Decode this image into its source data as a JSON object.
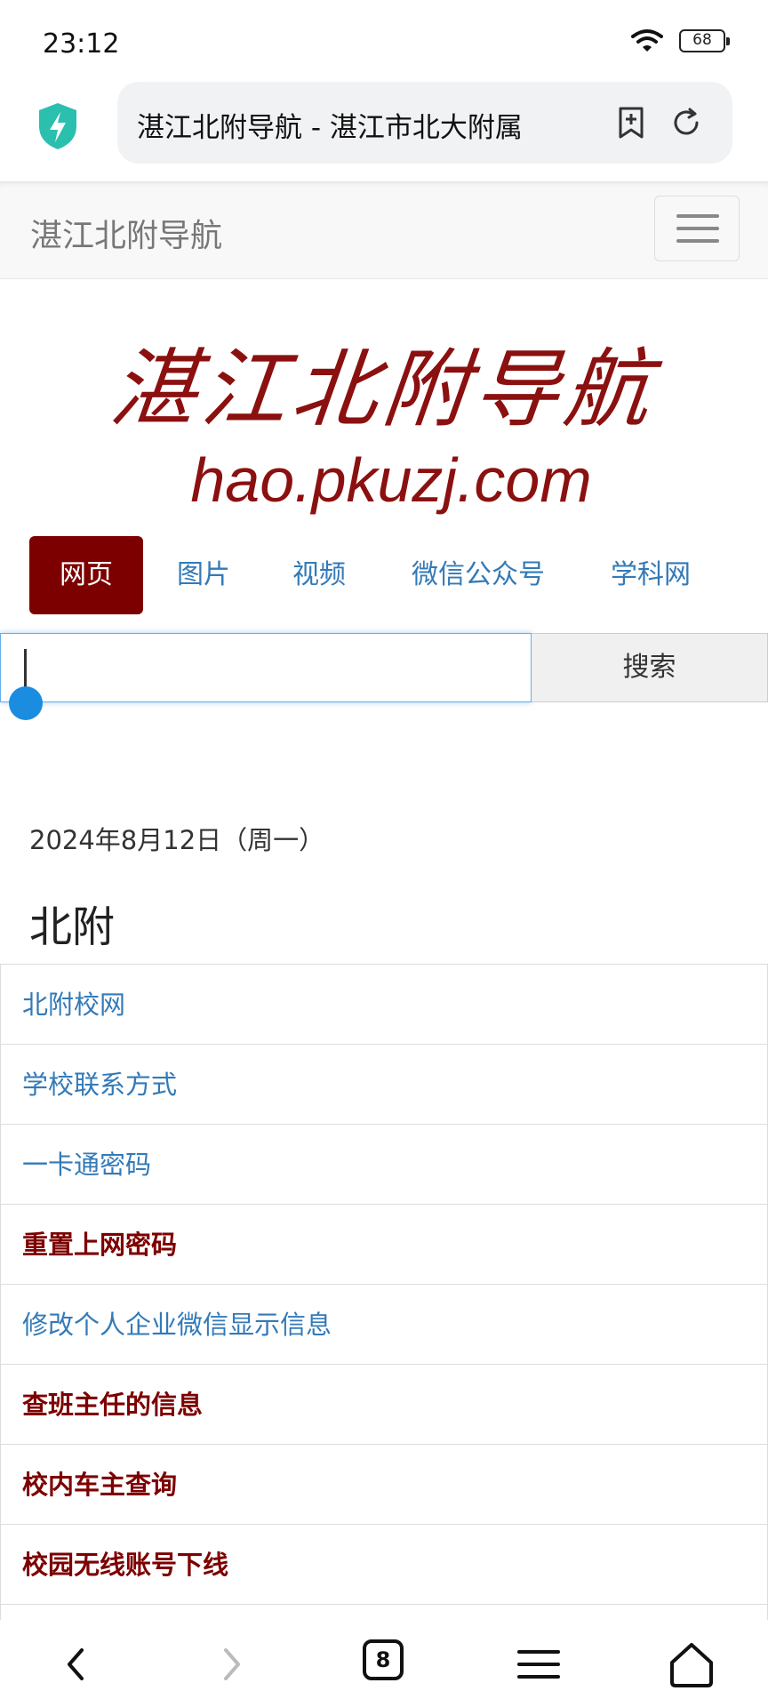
{
  "status_bar": {
    "time": "23:12",
    "battery": "68"
  },
  "browser": {
    "url_title": "湛江北附导航 - 湛江市北大附属",
    "tab_count": "8"
  },
  "navbar": {
    "brand": "湛江北附导航"
  },
  "logo": {
    "title": "湛江北附导航",
    "url": "hao.pkuzj.com"
  },
  "tabs": [
    {
      "label": "网页",
      "active": true
    },
    {
      "label": "图片",
      "active": false
    },
    {
      "label": "视频",
      "active": false
    },
    {
      "label": "微信公众号",
      "active": false
    },
    {
      "label": "学科网",
      "active": false
    }
  ],
  "search": {
    "value": "",
    "button_label": "搜索"
  },
  "date_text": "2024年8月12日（周一）",
  "section": {
    "title": "北附",
    "links": [
      {
        "label": "北附校网",
        "bold": false
      },
      {
        "label": "学校联系方式",
        "bold": false
      },
      {
        "label": "一卡通密码",
        "bold": false
      },
      {
        "label": "重置上网密码",
        "bold": true
      },
      {
        "label": "修改个人企业微信显示信息",
        "bold": false
      },
      {
        "label": "查班主任的信息",
        "bold": true
      },
      {
        "label": "校内车主查询",
        "bold": true
      },
      {
        "label": "校园无线账号下线",
        "bold": true
      }
    ]
  },
  "colors": {
    "brand_red": "#7d0000",
    "link_blue": "#337ab7",
    "accent_teal": "#2bbfae"
  }
}
